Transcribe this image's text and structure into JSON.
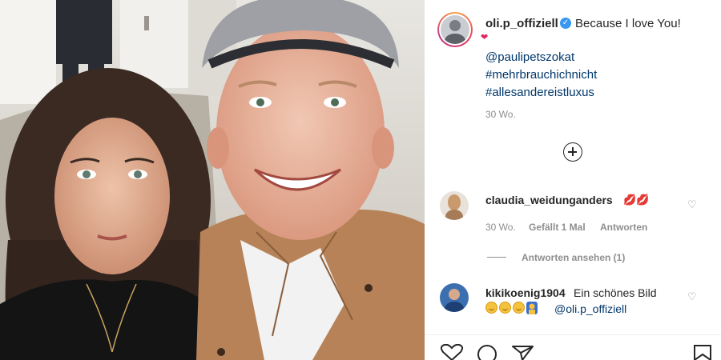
{
  "post": {
    "username": "oli.p_offiziell",
    "caption": "Because I love You!",
    "heart": "❤",
    "tags": [
      "@paulipetszokat",
      "#mehrbrauchichnicht",
      "#allesandereistluxus"
    ],
    "time": "30 Wo."
  },
  "comments": [
    {
      "username": "claudia_weidunganders",
      "emoji": "💋💋",
      "time": "30 Wo.",
      "likes": "Gefällt 1 Mal",
      "reply": "Antworten",
      "view_replies": "Antworten ansehen (1)"
    },
    {
      "username": "kikikoenig1904",
      "text": "Ein schönes Bild",
      "mention": "@oli.p_offiziell"
    }
  ],
  "icons": {
    "verified": "verified-badge-icon",
    "load_more": "plus-circle-icon",
    "like": "heart-icon",
    "comment": "comment-icon",
    "share": "paper-plane-icon",
    "save": "bookmark-icon"
  },
  "colors": {
    "link": "#00376b",
    "verified": "#3897f0",
    "meta": "#8e8e8e"
  }
}
